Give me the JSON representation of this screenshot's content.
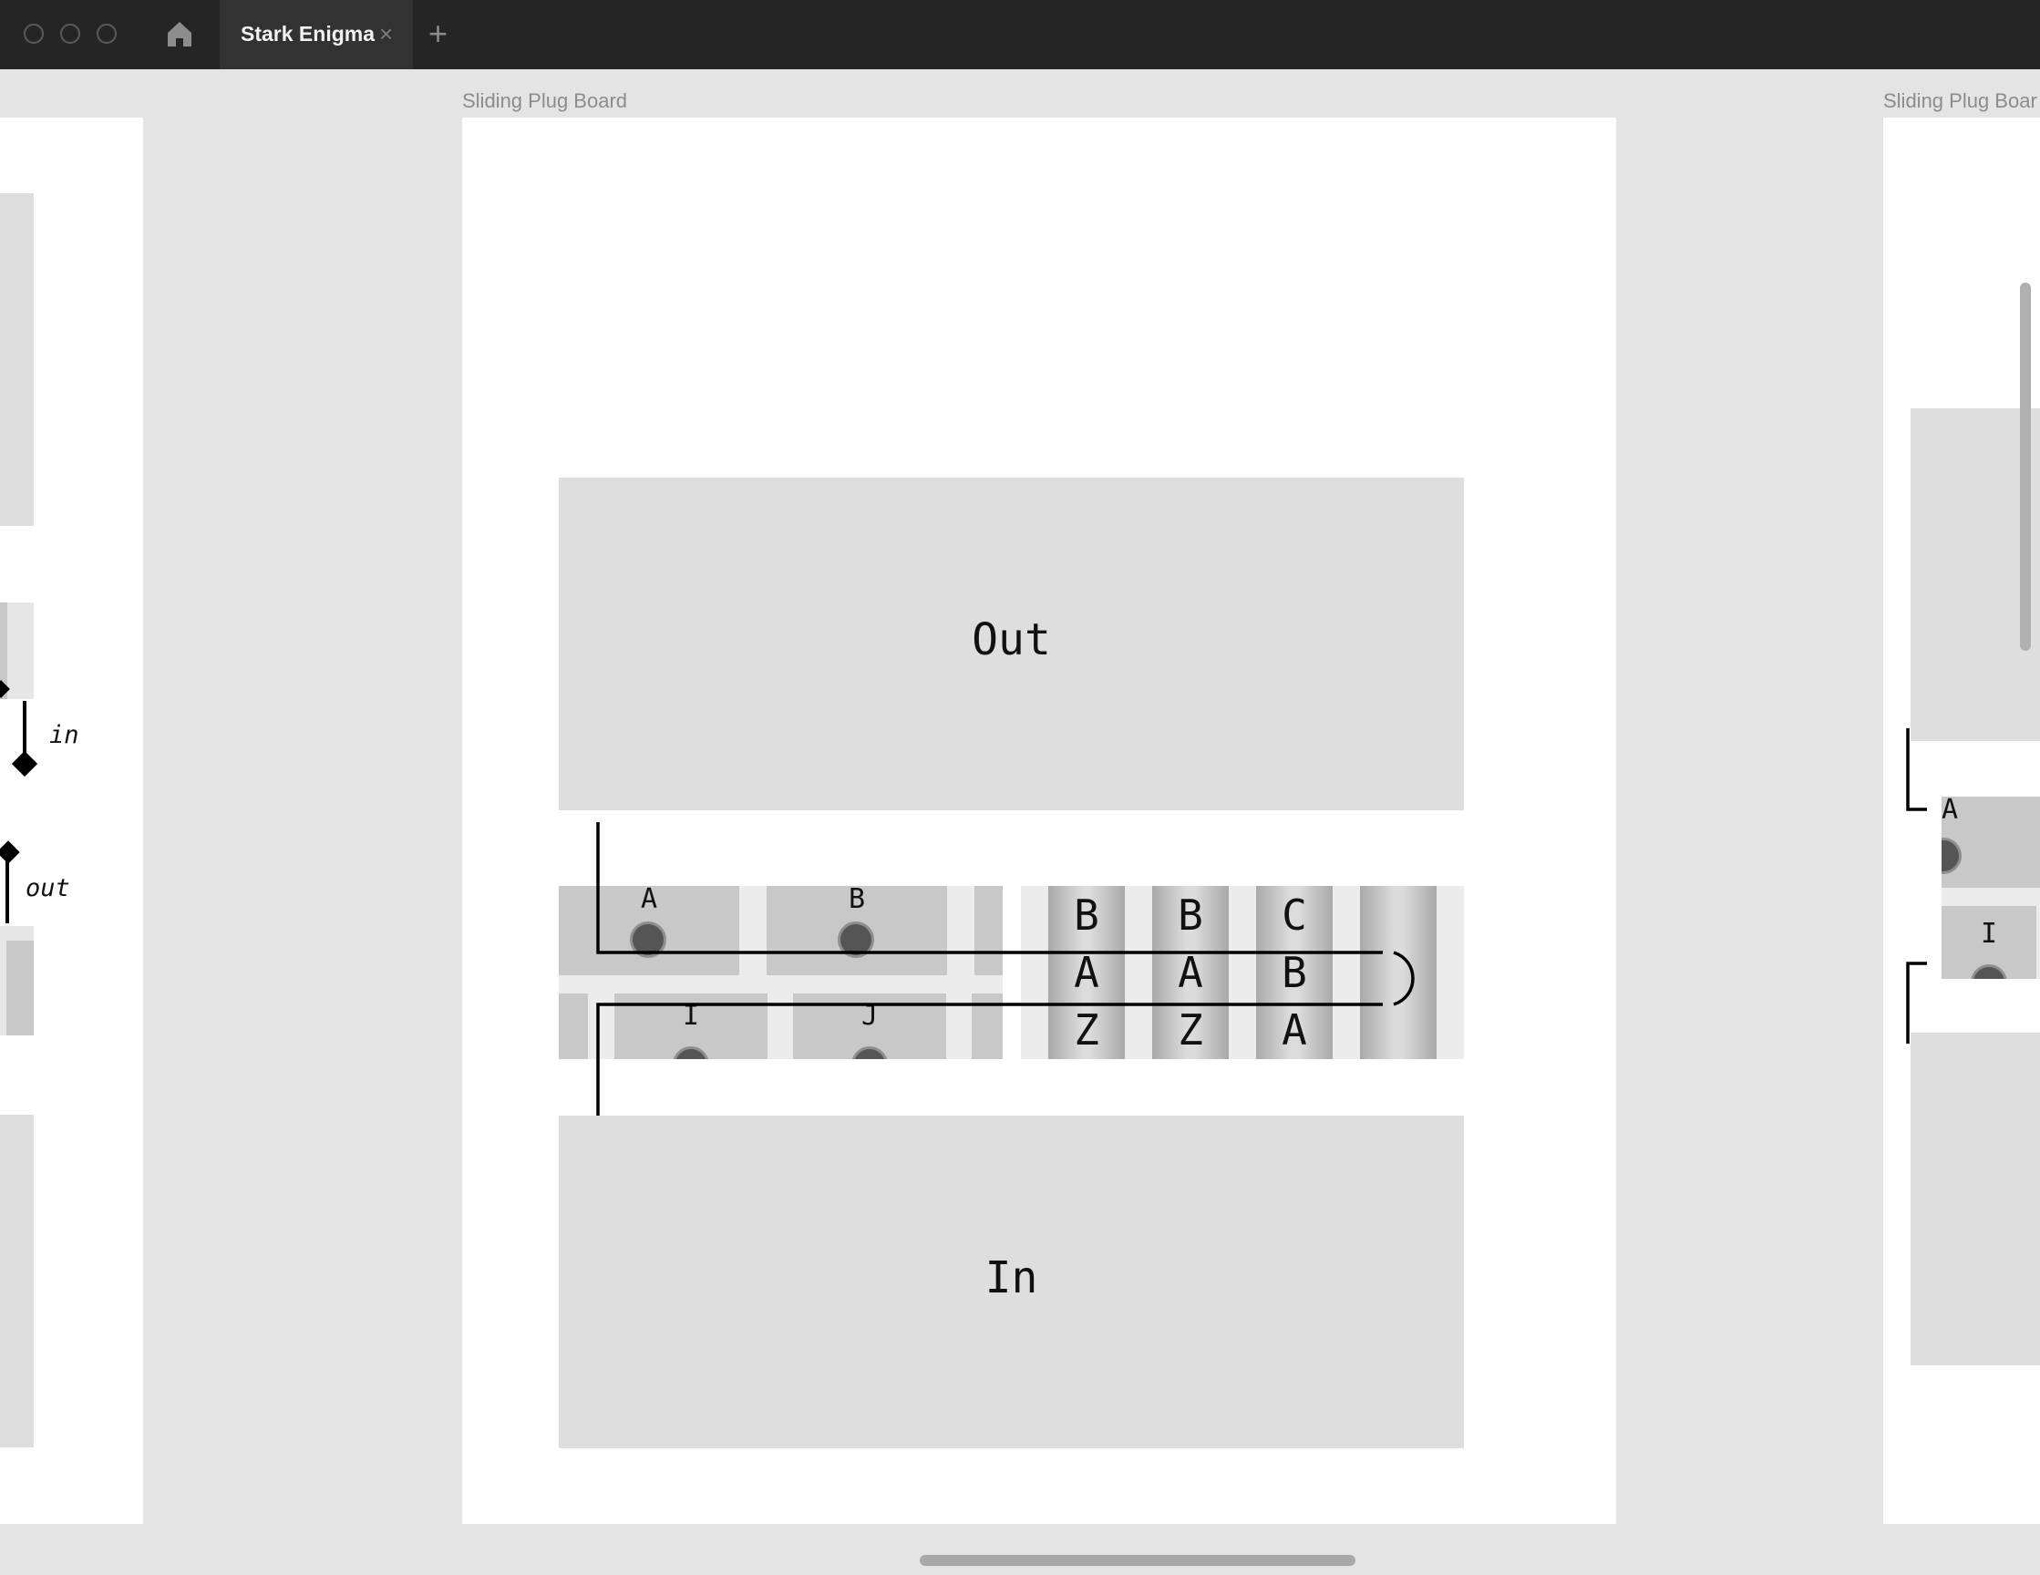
{
  "window": {
    "tab_title": "Stark Enigma",
    "tab_close": "×",
    "new_tab": "+"
  },
  "frames": {
    "main_label": "Sliding Plug Board",
    "right_label": "Sliding Plug Boar"
  },
  "main": {
    "out_label": "Out",
    "in_label": "In",
    "plugs_top": [
      "A",
      "B"
    ],
    "plugs_bottom": [
      "I",
      "J"
    ],
    "rotors": [
      [
        "B",
        "A",
        "Z"
      ],
      [
        "B",
        "A",
        "Z"
      ],
      [
        "C",
        "B",
        "A"
      ]
    ]
  },
  "left_frame": {
    "in_label": "in",
    "out_label": "out"
  },
  "right_frame": {
    "plug_top": "A",
    "plug_bottom": "I"
  }
}
